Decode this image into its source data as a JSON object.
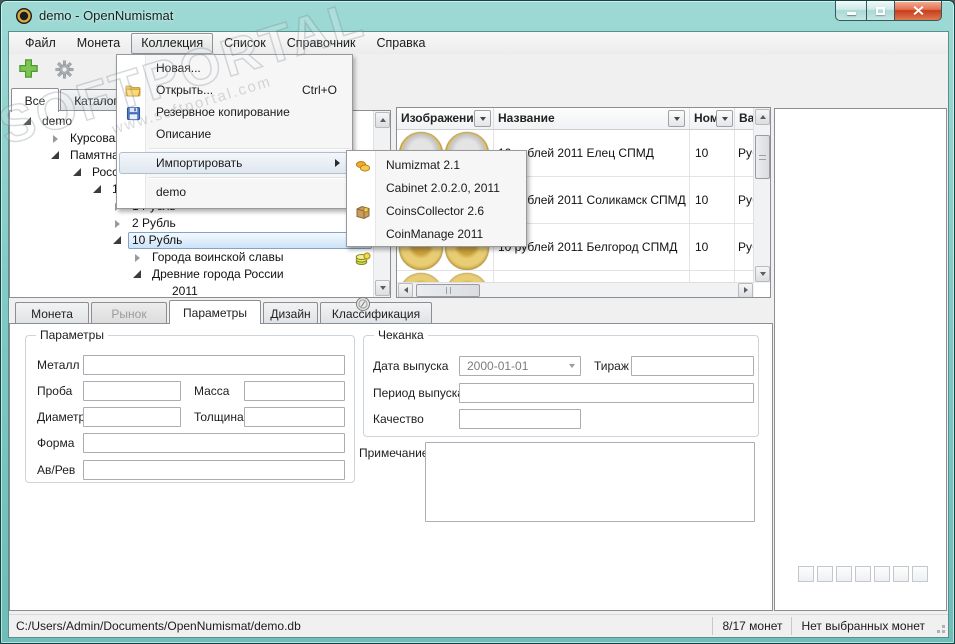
{
  "window": {
    "title": "demo - OpenNumismat"
  },
  "watermark": {
    "text": "SOFTPORTAL",
    "subtext": "www.softportal.com"
  },
  "menubar": {
    "items": [
      {
        "label": "Файл"
      },
      {
        "label": "Монета"
      },
      {
        "label": "Коллекция",
        "pressed": true
      },
      {
        "label": "Список"
      },
      {
        "label": "Справочник"
      },
      {
        "label": "Справка"
      }
    ]
  },
  "collection_menu": {
    "new": "Новая...",
    "open": "Открыть...",
    "open_shortcut": "Ctrl+O",
    "backup": "Резервное копирование",
    "description": "Описание",
    "import": "Импортировать",
    "recent": "demo"
  },
  "import_submenu": {
    "items": [
      {
        "label": "Numizmat 2.1",
        "icon": "coins-icon"
      },
      {
        "label": "Cabinet 2.0.2.0, 2011",
        "icon": "cabinet-icon"
      },
      {
        "label": "CoinsCollector 2.6",
        "icon": "coins-stack-icon"
      },
      {
        "label": "CoinManage 2011",
        "icon": "coin-disc-icon"
      }
    ]
  },
  "left_tabs": {
    "all": "Все",
    "catalog": "Каталог"
  },
  "tree": {
    "items": [
      {
        "label": "demo",
        "state": "expanded",
        "level": 0
      },
      {
        "label": "Курсовая (",
        "state": "collapsed",
        "level": 1
      },
      {
        "label": "Памятная",
        "state": "expanded",
        "level": 1
      },
      {
        "label": "Россия",
        "state": "expanded",
        "level": 2
      },
      {
        "label": "199",
        "state": "expanded",
        "level": 3
      },
      {
        "label": "1 Рубль",
        "state": "collapsed",
        "level": 4
      },
      {
        "label": "2 Рубль",
        "state": "collapsed",
        "level": 4
      },
      {
        "label": "10 Рубль",
        "state": "expanded",
        "level": 4,
        "selected": true
      },
      {
        "label": "Города воинской славы",
        "state": "collapsed",
        "level": 5
      },
      {
        "label": "Древние города России",
        "state": "expanded",
        "level": 5
      },
      {
        "label": "2011",
        "state": "leaf",
        "level": 6
      }
    ]
  },
  "table": {
    "headers": [
      {
        "label": "Изображени"
      },
      {
        "label": "Название"
      },
      {
        "label": "Ном"
      },
      {
        "label": "Вал"
      }
    ],
    "rows": [
      {
        "name": "10 рублей 2011 Елец СПМД",
        "nominal": "10",
        "currency": "Руб"
      },
      {
        "name": "10 рублей 2011 Соликамск СПМД",
        "nominal": "10",
        "currency": "Руб"
      },
      {
        "name": "10 рублей 2011 Белгород СПМД",
        "nominal": "10",
        "currency": "Руб"
      }
    ]
  },
  "bottom_tabs": {
    "items": [
      {
        "label": "Монета"
      },
      {
        "label": "Рынок",
        "disabled": true
      },
      {
        "label": "Параметры",
        "selected": true
      },
      {
        "label": "Дизайн"
      },
      {
        "label": "Классификация"
      }
    ]
  },
  "form": {
    "parameters_group": "Параметры",
    "metal": "Металл",
    "probe": "Проба",
    "mass": "Масса",
    "diameter": "Диаметр",
    "thickness": "Толщина",
    "shape": "Форма",
    "obvrev": "Ав/Рев",
    "minting_group": "Чеканка",
    "issue_date": "Дата выпуска",
    "issue_date_value": "2000-01-01",
    "mintage": "Тираж",
    "issue_period": "Период выпуска",
    "quality": "Качество",
    "note": "Примечание"
  },
  "statusbar": {
    "path": "C:/Users/Admin/Documents/OpenNumismat/demo.db",
    "coins_count": "8/17 монет",
    "selection": "Нет выбранных монет"
  },
  "colors": {
    "titlebar_teal": "#8fd1cd",
    "selection_blue": "#cde3f8",
    "close_red": "#c83c1e",
    "coin_gold": "#d4aa45",
    "coin_silver": "#d6d6d6"
  }
}
